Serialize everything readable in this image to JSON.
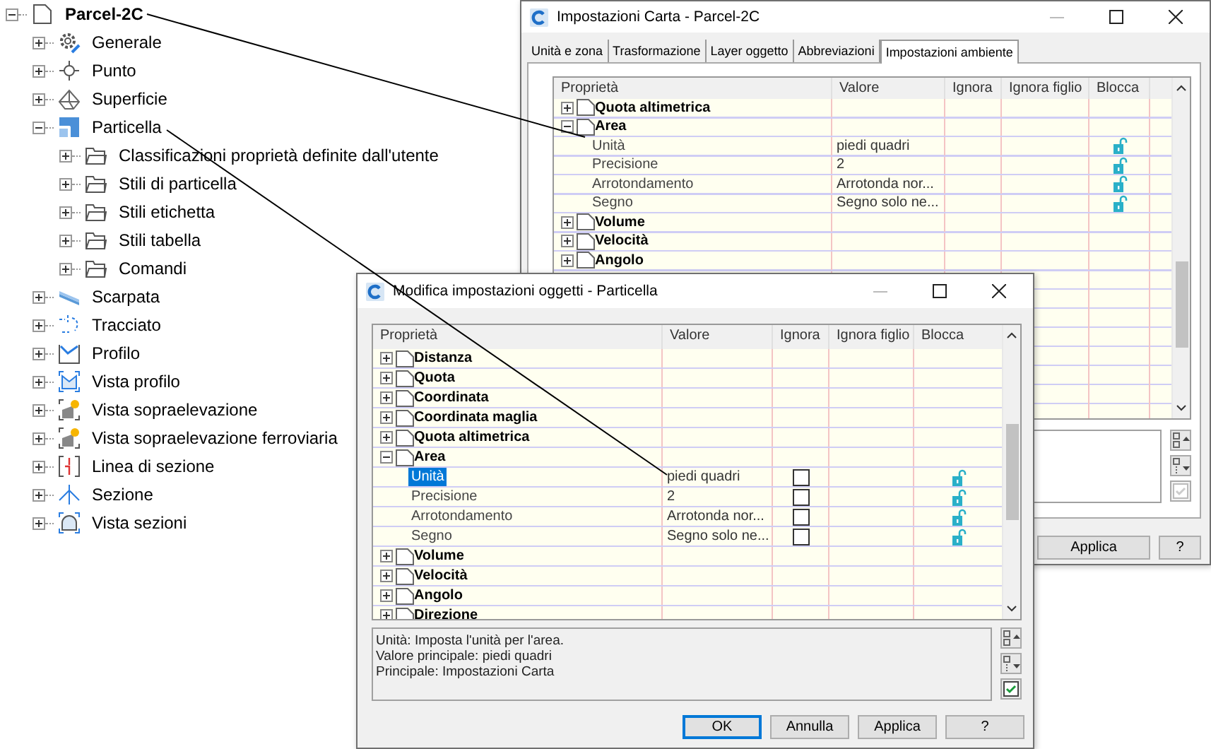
{
  "tree": {
    "label": "Parcel-2C",
    "kind": "drawing",
    "expanded": true,
    "children": [
      {
        "label": "Generale",
        "kind": "gear",
        "expanded": false
      },
      {
        "label": "Punto",
        "kind": "point",
        "expanded": false
      },
      {
        "label": "Superficie",
        "kind": "surface",
        "expanded": false
      },
      {
        "label": "Particella",
        "kind": "parcel",
        "expanded": true,
        "children": [
          {
            "label": "Classificazioni proprietà definite dall'utente",
            "kind": "folder",
            "expanded": false
          },
          {
            "label": "Stili di particella",
            "kind": "folder",
            "expanded": false
          },
          {
            "label": "Stili etichetta",
            "kind": "folder",
            "expanded": false
          },
          {
            "label": "Stili tabella",
            "kind": "folder",
            "expanded": false
          },
          {
            "label": "Comandi",
            "kind": "folder",
            "expanded": false
          }
        ]
      },
      {
        "label": "Scarpata",
        "kind": "slope",
        "expanded": false
      },
      {
        "label": "Tracciato",
        "kind": "alignment",
        "expanded": false
      },
      {
        "label": "Profilo",
        "kind": "profile",
        "expanded": false
      },
      {
        "label": "Vista profilo",
        "kind": "profile-view",
        "expanded": false
      },
      {
        "label": "Vista sopraelevazione",
        "kind": "superelevation",
        "expanded": false
      },
      {
        "label": "Vista sopraelevazione ferroviaria",
        "kind": "superelevation",
        "expanded": false
      },
      {
        "label": "Linea di sezione",
        "kind": "sample-line",
        "expanded": false
      },
      {
        "label": "Sezione",
        "kind": "section",
        "expanded": false
      },
      {
        "label": "Vista sezioni",
        "kind": "section-view",
        "expanded": false
      }
    ]
  },
  "dialogs": [
    {
      "title": "Impostazioni Carta - Parcel-2C",
      "tabs": [
        {
          "label": "Unità e zona",
          "selected": false
        },
        {
          "label": "Trasformazione",
          "selected": false
        },
        {
          "label": "Layer oggetto",
          "selected": false
        },
        {
          "label": "Abbreviazioni",
          "selected": false
        },
        {
          "label": "Impostazioni ambiente",
          "selected": true
        }
      ],
      "columns": [
        "Proprietà",
        "Valore",
        "Ignora",
        "Ignora figlio",
        "Blocca"
      ],
      "rows": [
        {
          "kind": "group",
          "label": "Quota altimetrica",
          "expanded": false
        },
        {
          "kind": "group",
          "label": "Area",
          "expanded": true
        },
        {
          "kind": "property",
          "label": "Unità",
          "value": "piedi quadri",
          "selected": false
        },
        {
          "kind": "property",
          "label": "Precisione",
          "value": "2",
          "selected": false
        },
        {
          "kind": "property",
          "label": "Arrotondamento",
          "value": "Arrotonda nor...",
          "selected": false
        },
        {
          "kind": "property",
          "label": "Segno",
          "value": "Segno solo ne...",
          "selected": false
        },
        {
          "kind": "group",
          "label": "Volume",
          "expanded": false
        },
        {
          "kind": "group",
          "label": "Velocità",
          "expanded": false
        },
        {
          "kind": "group",
          "label": "Angolo",
          "expanded": false
        }
      ],
      "check_button_enabled": false,
      "buttons": [
        {
          "label": "Applica",
          "default": false
        },
        {
          "label": "?",
          "default": false
        }
      ]
    },
    {
      "title": "Modifica impostazioni oggetti - Particella",
      "columns": [
        "Proprietà",
        "Valore",
        "Ignora",
        "Ignora figlio",
        "Blocca"
      ],
      "rows": [
        {
          "kind": "group",
          "label": "Distanza",
          "expanded": false
        },
        {
          "kind": "group",
          "label": "Quota",
          "expanded": false
        },
        {
          "kind": "group",
          "label": "Coordinata",
          "expanded": false
        },
        {
          "kind": "group",
          "label": "Coordinata maglia",
          "expanded": false
        },
        {
          "kind": "group",
          "label": "Quota altimetrica",
          "expanded": false
        },
        {
          "kind": "group",
          "label": "Area",
          "expanded": true
        },
        {
          "kind": "property",
          "label": "Unità",
          "value": "piedi quadri",
          "selected": true,
          "ignore_checked": false
        },
        {
          "kind": "property",
          "label": "Precisione",
          "value": "2",
          "selected": false,
          "ignore_checked": false
        },
        {
          "kind": "property",
          "label": "Arrotondamento",
          "value": "Arrotonda nor...",
          "selected": false,
          "ignore_checked": false
        },
        {
          "kind": "property",
          "label": "Segno",
          "value": "Segno solo ne...",
          "selected": false,
          "ignore_checked": false
        },
        {
          "kind": "group",
          "label": "Volume",
          "expanded": false
        },
        {
          "kind": "group",
          "label": "Velocità",
          "expanded": false
        },
        {
          "kind": "group",
          "label": "Angolo",
          "expanded": false
        },
        {
          "kind": "group",
          "label": "Direzione",
          "expanded": false
        }
      ],
      "description": [
        "Unità: Imposta l'unità per l'area.",
        "Valore principale: piedi quadri",
        "Principale: Impostazioni Carta"
      ],
      "check_button_enabled": true,
      "buttons": [
        {
          "label": "OK",
          "default": true
        },
        {
          "label": "Annulla",
          "default": false
        },
        {
          "label": "Applica",
          "default": false
        },
        {
          "label": "?",
          "default": false
        }
      ]
    }
  ]
}
